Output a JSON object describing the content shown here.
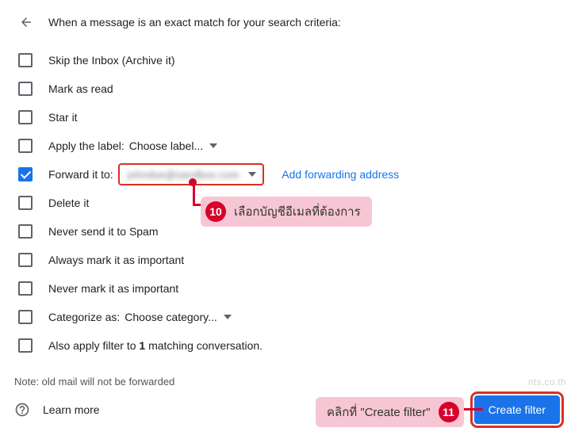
{
  "header": {
    "title": "When a message is an exact match for your search criteria:"
  },
  "options": {
    "skip_inbox": "Skip the Inbox (Archive it)",
    "mark_read": "Mark as read",
    "star_it": "Star it",
    "apply_label": "Apply the label:",
    "apply_label_select": "Choose label...",
    "forward_to": "Forward it to:",
    "forward_to_value": "johndoe@sandbox.com",
    "add_forwarding": "Add forwarding address",
    "delete_it": "Delete it",
    "never_spam": "Never send it to Spam",
    "always_important": "Always mark it as important",
    "never_important": "Never mark it as important",
    "categorize_as": "Categorize as:",
    "categorize_select": "Choose category...",
    "also_apply_pre": "Also apply filter to ",
    "also_apply_num": "1",
    "also_apply_post": " matching conversation."
  },
  "note": "Note: old mail will not be forwarded",
  "footer": {
    "learn_more": "Learn more",
    "create_filter": "Create filter"
  },
  "annotations": {
    "step10_num": "10",
    "step10_text": "เลือกบัญชีอีเมลที่ต้องการ",
    "step11_num": "11",
    "step11_text": "คลิกที่ \"Create filter\""
  },
  "watermark": "nts.co.th"
}
